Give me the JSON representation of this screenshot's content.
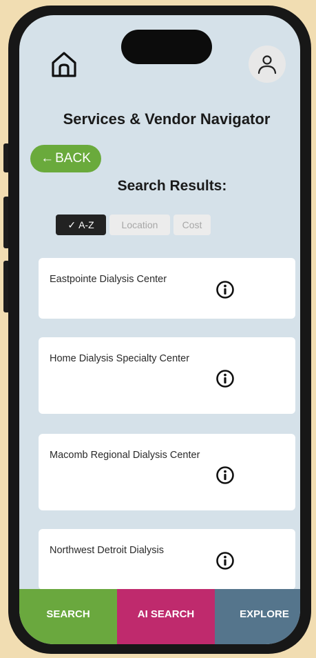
{
  "header": {
    "title": "Services & Vendor Navigator",
    "home_icon": "home-icon",
    "avatar_icon": "user-icon"
  },
  "back": {
    "arrow": "←",
    "label": "BACK"
  },
  "results_heading": "Search Results:",
  "filters": {
    "az": {
      "check": "✓",
      "label": "A-Z",
      "selected": true
    },
    "location": {
      "label": "Location",
      "selected": false
    },
    "cost": {
      "label": "Cost",
      "selected": false
    }
  },
  "results": [
    {
      "name": "Eastpointe Dialysis Center"
    },
    {
      "name": "Home Dialysis Specialty Center"
    },
    {
      "name": "Macomb Regional Dialysis Center"
    },
    {
      "name": "Northwest Detroit Dialysis"
    }
  ],
  "bottom_nav": {
    "search": "SEARCH",
    "ai_search": "AI SEARCH",
    "explore": "EXPLORE"
  },
  "colors": {
    "screen_bg": "#d5e1e9",
    "back_green": "#6aaa3c",
    "search_green": "#6aa83e",
    "ai_magenta": "#bf2a6d",
    "explore_slate": "#55758c",
    "page_bg": "#f1ddb2"
  }
}
